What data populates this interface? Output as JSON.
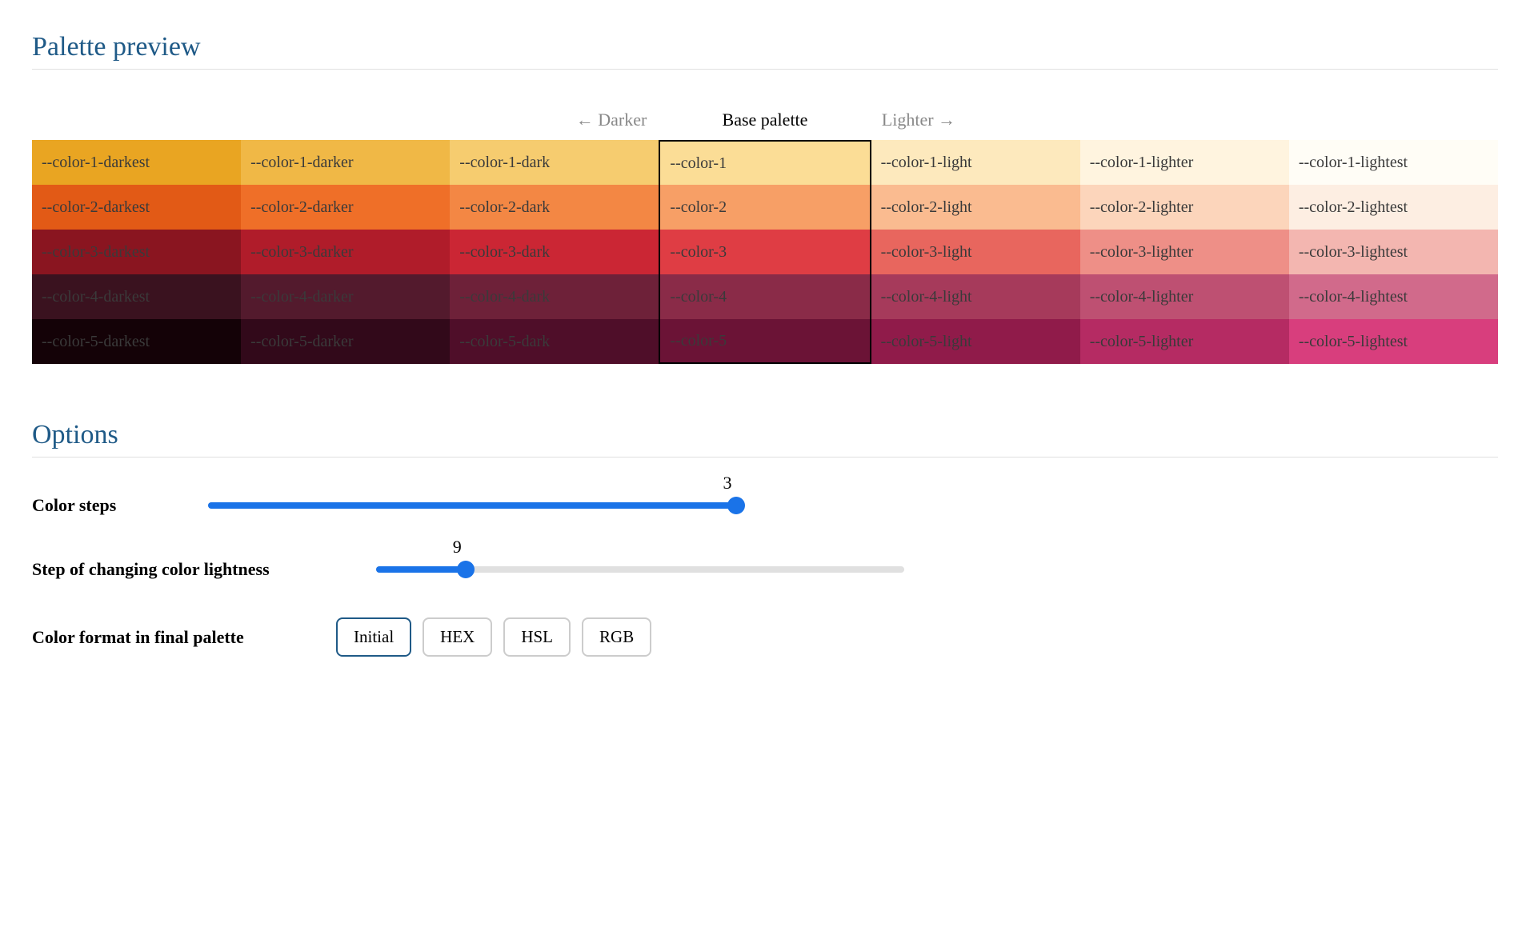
{
  "preview": {
    "title": "Palette preview",
    "header_left": "← Darker",
    "header_center": "Base palette",
    "header_right": "Lighter →",
    "columns": [
      "darkest",
      "darker",
      "dark",
      "base",
      "light",
      "lighter",
      "lightest"
    ],
    "rows": [
      {
        "id": 1,
        "labels": [
          "--color-1-darkest",
          "--color-1-darker",
          "--color-1-dark",
          "--color-1",
          "--color-1-light",
          "--color-1-lighter",
          "--color-1-lightest"
        ],
        "colors": [
          "#e9a522",
          "#f0b846",
          "#f6cc6f",
          "#fbdd96",
          "#fde9bd",
          "#fff4df",
          "#fffdf6"
        ]
      },
      {
        "id": 2,
        "labels": [
          "--color-2-darkest",
          "--color-2-darker",
          "--color-2-dark",
          "--color-2",
          "--color-2-light",
          "--color-2-lighter",
          "--color-2-lightest"
        ],
        "colors": [
          "#e25a16",
          "#ef6f28",
          "#f38744",
          "#f79f66",
          "#fabb90",
          "#fcd5bb",
          "#fdeee2"
        ]
      },
      {
        "id": 3,
        "labels": [
          "--color-3-darkest",
          "--color-3-darker",
          "--color-3-dark",
          "--color-3",
          "--color-3-light",
          "--color-3-lighter",
          "--color-3-lightest"
        ],
        "colors": [
          "#8a1520",
          "#b01c2a",
          "#cb2634",
          "#df3d44",
          "#e8665e",
          "#ee8f87",
          "#f3b6b0"
        ]
      },
      {
        "id": 4,
        "labels": [
          "--color-4-darkest",
          "--color-4-darker",
          "--color-4-dark",
          "--color-4",
          "--color-4-light",
          "--color-4-lighter",
          "--color-4-lightest"
        ],
        "colors": [
          "#3a121f",
          "#531a2d",
          "#6e2139",
          "#8a2b48",
          "#a63a5b",
          "#be5072",
          "#d16a8b"
        ]
      },
      {
        "id": 5,
        "labels": [
          "--color-5-darkest",
          "--color-5-darker",
          "--color-5-dark",
          "--color-5",
          "--color-5-light",
          "--color-5-lighter",
          "--color-5-lightest"
        ],
        "colors": [
          "#140207",
          "#32091a",
          "#4f0e29",
          "#6b1336",
          "#901b4a",
          "#b52b63",
          "#d83e7d"
        ]
      }
    ]
  },
  "options": {
    "title": "Options",
    "color_steps_label": "Color steps",
    "color_steps_value": "3",
    "lightness_label": "Step of changing color lightness",
    "lightness_value": "9",
    "format_label": "Color format in final palette",
    "formats": [
      "Initial",
      "HEX",
      "HSL",
      "RGB"
    ],
    "format_selected": "Initial",
    "slider1_percent": 100,
    "slider2_percent": 17
  }
}
